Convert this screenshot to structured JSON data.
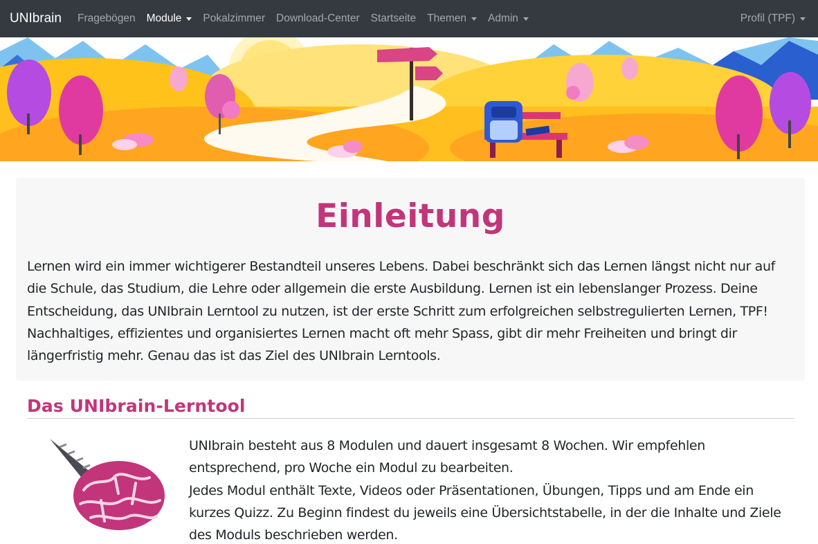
{
  "navbar": {
    "brand": "UNIbrain",
    "items": [
      {
        "label": "Fragebögen"
      },
      {
        "label": "Module"
      },
      {
        "label": "Pokalzimmer"
      },
      {
        "label": "Download-Center"
      },
      {
        "label": "Startseite"
      },
      {
        "label": "Themen"
      },
      {
        "label": "Admin"
      }
    ],
    "profile": "Profil (TPF)",
    "background_color": "#343a40"
  },
  "intro": {
    "title": "Einleitung",
    "text": "Lernen wird ein immer wichtigerer Bestandteil unseres Lebens. Dabei beschränkt sich das Lernen längst nicht nur auf die Schule, das Studium, die Lehre oder allgemein die erste Ausbildung. Lernen ist ein lebenslanger Prozess. Deine Entscheidung, das UNIbrain Lerntool zu nutzen, ist der erste Schritt zum erfolgreichen selbstregulierten Lernen, TPF! Nachhaltiges, effizientes und organisiertes Lernen macht oft mehr Spass, gibt dir mehr Freiheiten und bringt dir längerfristig mehr. Genau das ist das Ziel des UNIbrain Lerntools."
  },
  "section": {
    "title": "Das UNIbrain-Lerntool",
    "line1": "UNIbrain besteht aus 8 Modulen und dauert insgesamt 8 Wochen. Wir empfehlen entsprechend, pro Woche ein Modul zu bearbeiten.",
    "line2": "Jedes Modul enthält Texte, Videos oder Präsentationen, Übungen, Tipps und am Ende ein kurzes Quizz. Zu Beginn findest du jeweils eine Übersichtstabelle, in der die Inhalte und Ziele des Moduls beschrieben werden."
  },
  "colors": {
    "accent": "#c2357a",
    "intro_background": "#f7f7f7"
  },
  "icons": [
    "chevron-down-icon",
    "unicorn-brain-logo"
  ]
}
